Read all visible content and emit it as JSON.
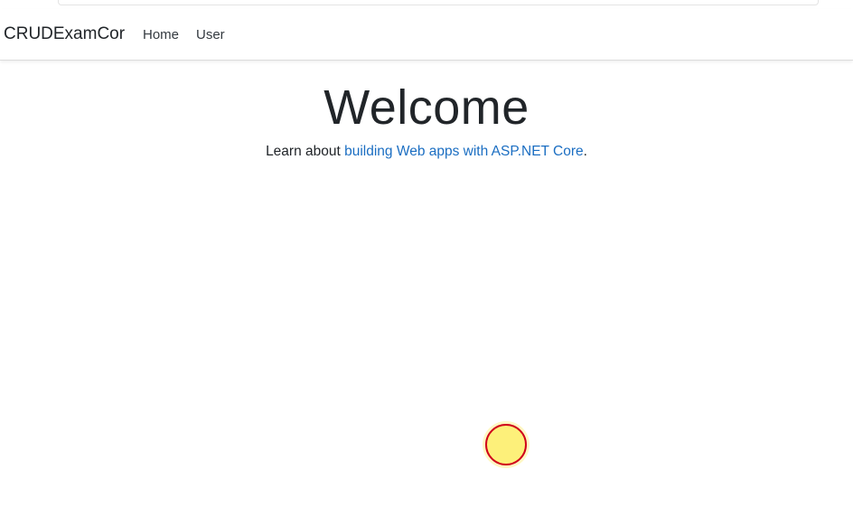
{
  "navbar": {
    "brand": "CRUDExamCor",
    "links": [
      {
        "label": "Home"
      },
      {
        "label": "User"
      }
    ]
  },
  "main": {
    "title": "Welcome",
    "learn_prefix": "Learn about ",
    "learn_link": "building Web apps with ASP.NET Core",
    "learn_suffix": "."
  },
  "colors": {
    "link": "#1b6ec2",
    "cursor_fill": "#fdf07a",
    "cursor_ring": "#d0021b"
  }
}
